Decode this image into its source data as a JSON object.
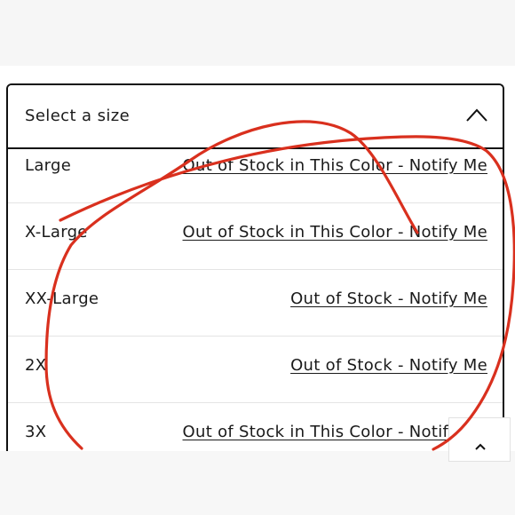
{
  "dropdown": {
    "placeholder": "Select a size",
    "chevron_icon": "chevron-up-icon"
  },
  "sizes": [
    {
      "size": "Large",
      "status": "Out of Stock in This Color - Notify Me"
    },
    {
      "size": "X-Large",
      "status": "Out of Stock in This Color - Notify Me"
    },
    {
      "size": "XX-Large",
      "status": "Out of Stock - Notify Me"
    },
    {
      "size": "2X",
      "status": "Out of Stock - Notify Me"
    },
    {
      "size": "3X",
      "status": "Out of Stock in This Color - Notify Me"
    }
  ],
  "scroll_top_icon": "chevron-up-icon",
  "annotation": {
    "color": "#d9301e"
  }
}
